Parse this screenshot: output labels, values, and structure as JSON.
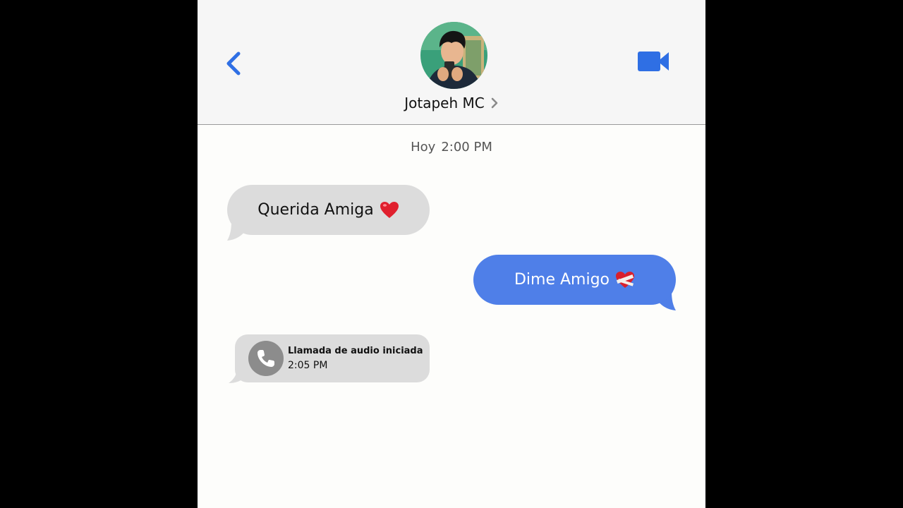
{
  "header": {
    "contact_name": "Jotapeh MC",
    "back_icon": "chevron-left-icon",
    "video_icon": "video-camera-icon",
    "accent_color": "#2f6fe4"
  },
  "conversation": {
    "timestamp_day": "Hoy",
    "timestamp_time": "2:00 PM",
    "messages": [
      {
        "direction": "incoming",
        "text": "Querida Amiga",
        "emoji": "red-heart"
      },
      {
        "direction": "outgoing",
        "text": "Dime Amigo",
        "emoji": "mending-heart"
      }
    ],
    "call": {
      "title": "Llamada de audio iniciada",
      "time": "2:05 PM",
      "icon": "phone-icon"
    }
  },
  "colors": {
    "incoming_bubble": "#dcdcdc",
    "outgoing_bubble": "#4f7fe8",
    "background": "#fdfdfb",
    "header_background": "#f6f6f6"
  }
}
